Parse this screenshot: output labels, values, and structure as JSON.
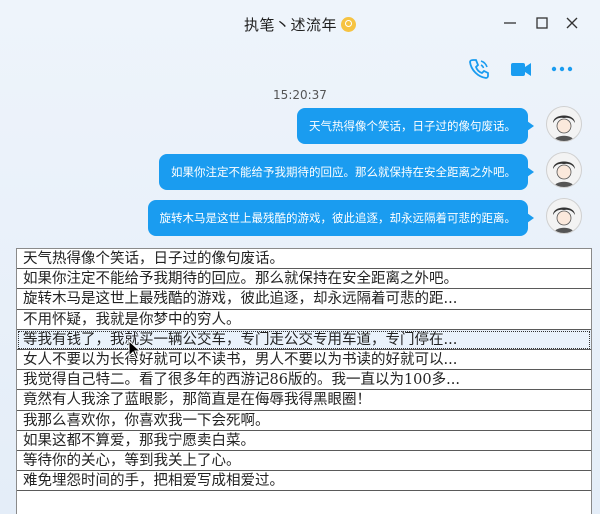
{
  "window": {
    "title": "执笔丶述流年",
    "title_badge": "vip-badge-icon",
    "controls": [
      "minimize-icon",
      "maximize-icon",
      "close-icon"
    ]
  },
  "toolbar": {
    "icons": [
      "phone-call-icon",
      "video-call-icon",
      "more-icon"
    ],
    "accent": "#1a9cf0"
  },
  "chat": {
    "timestamp": "15:20:37",
    "messages": [
      {
        "text": "天气热得像个笑话，日子过的像句废话。"
      },
      {
        "text": "如果你注定不能给予我期待的回应。那么就保持在安全距离之外吧。"
      },
      {
        "text": "旋转木马是这世上最残酷的游戏，彼此追逐，却永远隔着可悲的距离。"
      }
    ]
  },
  "list": {
    "selected_index": 4,
    "items": [
      "天气热得像个笑话，日子过的像句废话。",
      "如果你注定不能给予我期待的回应。那么就保持在安全距离之外吧。",
      "旋转木马是这世上最残酷的游戏，彼此追逐，却永远隔着可悲的距...",
      "不用怀疑，我就是你梦中的穷人。",
      "等我有钱了，我就买一辆公交车，专门走公交专用车道，专门停在...",
      "女人不要以为长得好就可以不读书，男人不要以为书读的好就可以...",
      "我觉得自己特二。看了很多年的西游记86版的。我一直以为100多...",
      "竟然有人我涂了蓝眼影，那简直是在侮辱我得黑眼圈！",
      "我那么喜欢你，你喜欢我一下会死啊。",
      "如果这都不算爱，那我宁愿卖白菜。",
      "等待你的关心，等到我关上了心。",
      "难免埋怨时间的手，把相爱写成相爱过。"
    ]
  }
}
